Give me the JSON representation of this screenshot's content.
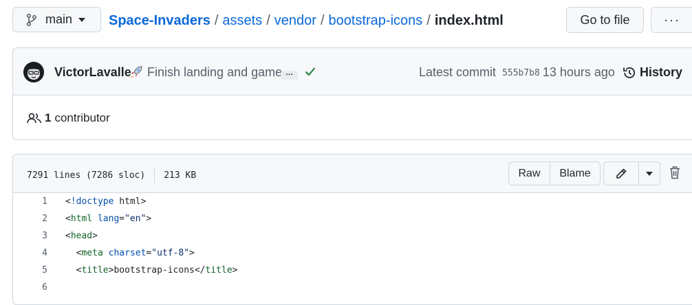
{
  "breadcrumb": {
    "branch": "main",
    "repo": "Space-Invaders",
    "path": [
      "assets",
      "vendor",
      "bootstrap-icons"
    ],
    "file": "index.html",
    "separator": "/"
  },
  "toolbar": {
    "goto_label": "Go to file",
    "more_label": "···"
  },
  "commit": {
    "author": "VictorLavalle",
    "message": "Finish landing and game",
    "ellipsis": "…",
    "latest_label": "Latest commit",
    "sha": "555b7b8",
    "time": "13 hours ago",
    "history_label": "History"
  },
  "contributors": {
    "count": "1",
    "label": "contributor"
  },
  "file": {
    "lines": "7291 lines (7286 sloc)",
    "size": "213 KB",
    "raw_label": "Raw",
    "blame_label": "Blame"
  },
  "code": {
    "line_numbers": [
      "1",
      "2",
      "3",
      "4",
      "5",
      "6"
    ],
    "l1": {
      "open": "<",
      "tag": "!doctype",
      "rest": " html>"
    },
    "l2": {
      "open": "<",
      "tag": "html",
      "attr": "lang",
      "eq": "=",
      "val": "\"en\"",
      "close": ">"
    },
    "l3": {
      "open": "<",
      "tag": "head",
      "close": ">"
    },
    "l4": {
      "indent": "  ",
      "open": "<",
      "tag": "meta",
      "attr": "charset",
      "eq": "=",
      "val": "\"utf-8\"",
      "close": ">"
    },
    "l5": {
      "indent": "  ",
      "open": "<",
      "tag": "title",
      "close": ">",
      "text": "bootstrap-icons",
      "endopen": "</",
      "endtag": "title",
      "endclose": ">"
    }
  },
  "colors": {
    "link": "#0969da",
    "success": "#1a7f37",
    "border": "#d0d7de",
    "header_bg": "#f6f8fa"
  }
}
